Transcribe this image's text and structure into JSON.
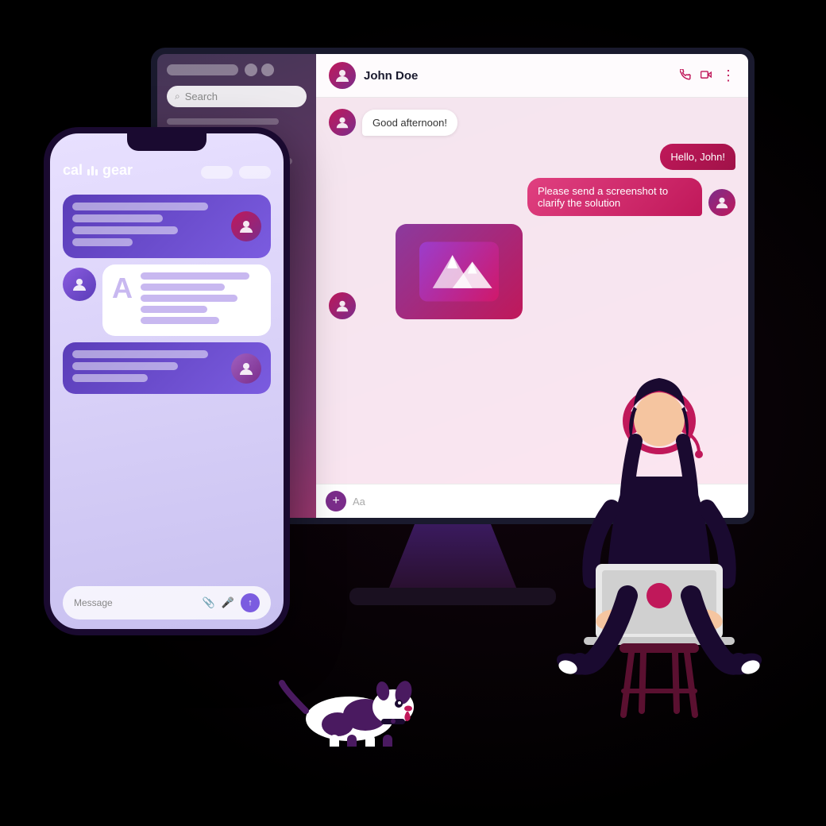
{
  "app": {
    "name": "call·gear",
    "background": "#000000"
  },
  "monitor": {
    "chat": {
      "contact_name": "John Doe",
      "search_placeholder": "Search",
      "messages": [
        {
          "id": 1,
          "side": "left",
          "text": "Good afternoon!",
          "avatar": true
        },
        {
          "id": 2,
          "side": "right",
          "text": "Hello, John!"
        },
        {
          "id": 3,
          "side": "right",
          "text": "Please send a screenshot to clarify the solution"
        },
        {
          "id": 4,
          "side": "left",
          "type": "image",
          "avatar": true
        }
      ],
      "input_placeholder": "Aa"
    }
  },
  "phone": {
    "logo": "call·gear",
    "message_placeholder": "Message"
  },
  "icons": {
    "search": "🔍",
    "phone_call": "📞",
    "video": "📹",
    "more": "⋯",
    "add": "+",
    "paperclip": "📎",
    "microphone": "🎤",
    "send": "↑",
    "person": "👤"
  }
}
